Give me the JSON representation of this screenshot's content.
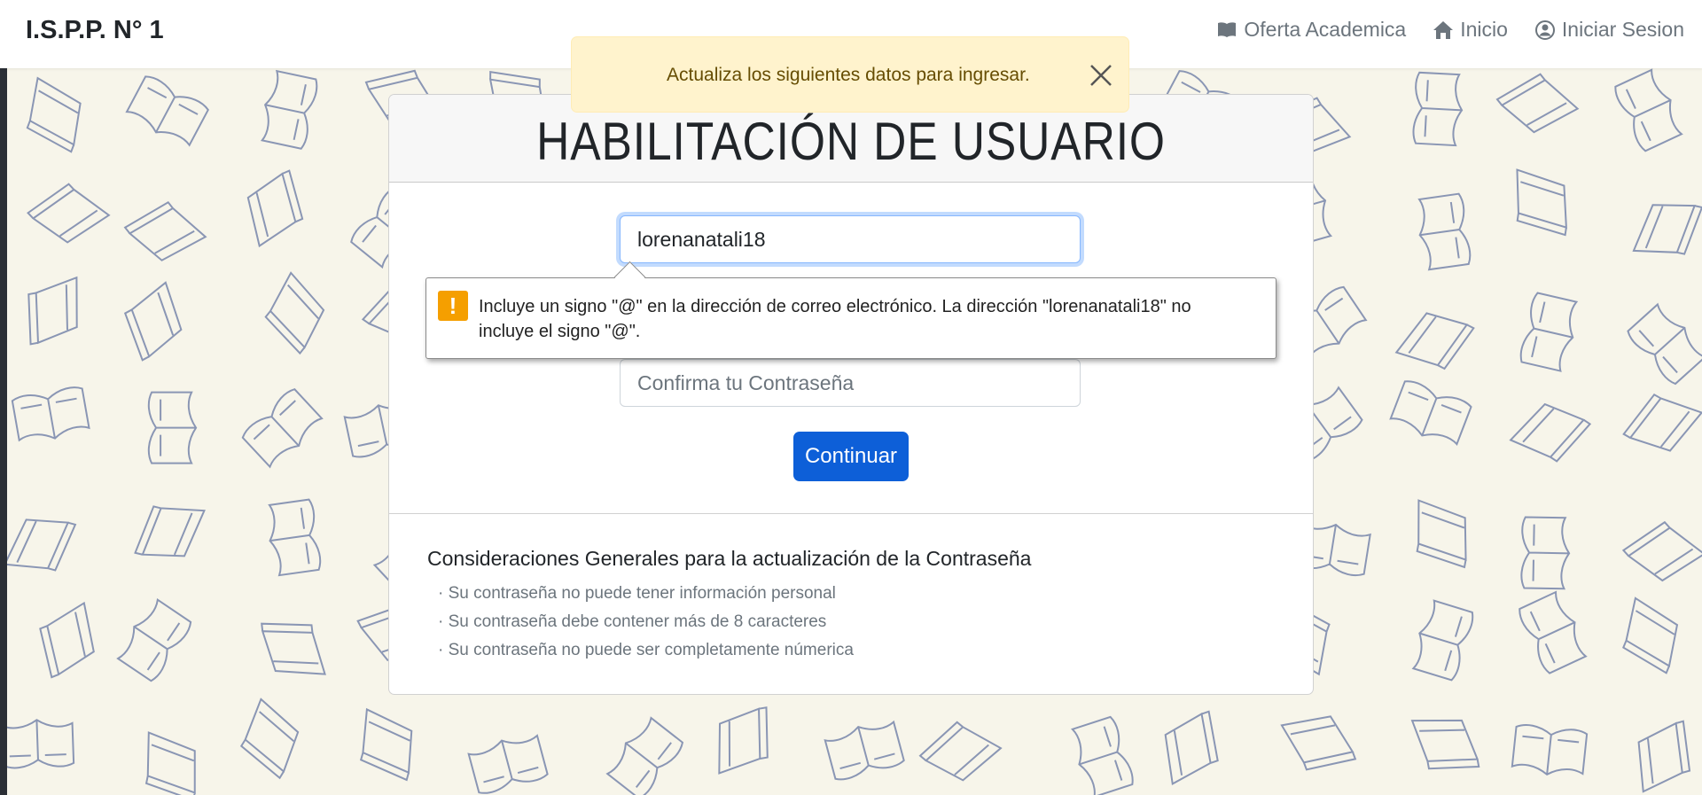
{
  "navbar": {
    "brand": "I.S.P.P. N° 1",
    "links": [
      {
        "label": "Oferta Academica",
        "icon": "book-icon"
      },
      {
        "label": "Inicio",
        "icon": "home-icon"
      },
      {
        "label": "Iniciar Sesion",
        "icon": "user-circle-icon"
      }
    ]
  },
  "alert": {
    "message": "Actualiza los siguientes datos para ingresar.",
    "close_icon": "close-icon",
    "color": "#fff3cd"
  },
  "card": {
    "title": "HABILITACIÓN DE USUARIO",
    "email_field": {
      "value": "lorenanatali18"
    },
    "confirm_password_field": {
      "placeholder": "Confirma tu Contraseña"
    },
    "continue_button": "Continuar",
    "considerations_title": "Consideraciones Generales para la actualización de la Contraseña",
    "rules": [
      "· Su contraseña no puede tener información personal",
      "· Su contraseña debe contener más de 8 caracteres",
      "· Su contraseña no puede ser completamente númerica"
    ]
  },
  "validation_tooltip": {
    "icon": "warning-icon",
    "message": "Incluye un signo \"@\" en la dirección de correo electrónico. La dirección \"lorenanatali18\" no incluye el signo \"@\"."
  },
  "colors": {
    "primary_button": "#0d5fd8",
    "background": "#f7f5ea",
    "doodle": "#8a96b4"
  }
}
